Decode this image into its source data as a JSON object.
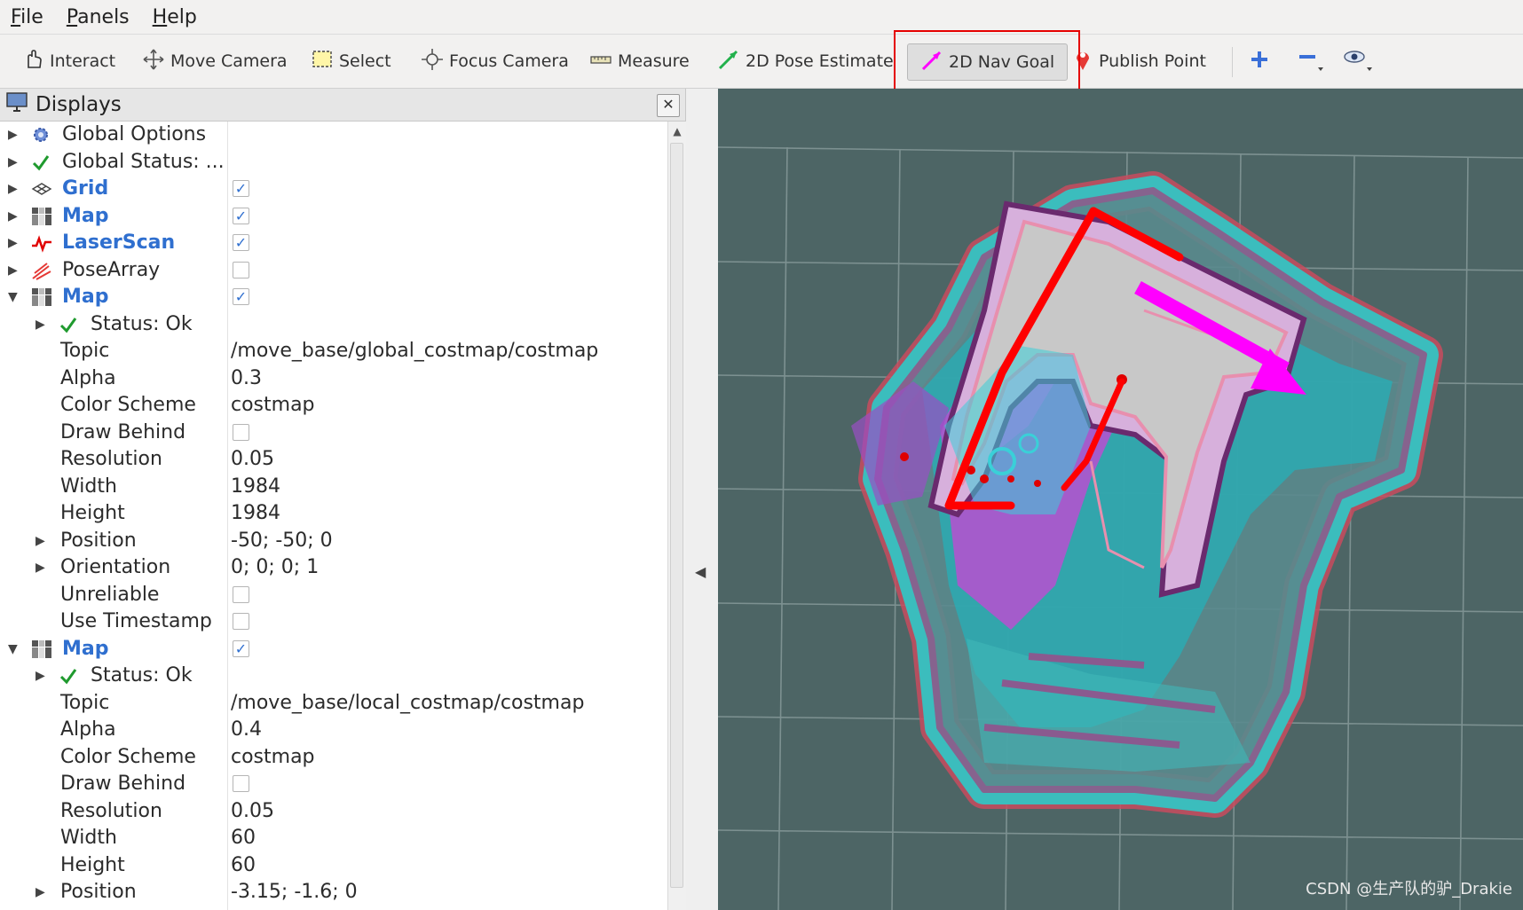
{
  "menubar": {
    "items": [
      "File",
      "Panels",
      "Help"
    ]
  },
  "toolbar": {
    "tools": [
      {
        "label": "Interact",
        "icon": "hand-icon"
      },
      {
        "label": "Move Camera",
        "icon": "move-camera-icon"
      },
      {
        "label": "Select",
        "icon": "select-icon"
      },
      {
        "label": "Focus Camera",
        "icon": "focus-camera-icon"
      },
      {
        "label": "Measure",
        "icon": "ruler-icon"
      },
      {
        "label": "2D Pose Estimate",
        "icon": "green-arrow-icon"
      },
      {
        "label": "2D Nav Goal",
        "icon": "magenta-arrow-icon",
        "active": true
      },
      {
        "label": "Publish Point",
        "icon": "map-pin-icon"
      }
    ],
    "extra_icons": [
      "plus-icon",
      "minus-icon",
      "eye-icon"
    ]
  },
  "displays_panel": {
    "title": "Displays",
    "rows": [
      {
        "label": "Global Options"
      },
      {
        "label": "Global Status: ..."
      },
      {
        "label": "Grid",
        "checked": true
      },
      {
        "label": "Map",
        "checked": true
      },
      {
        "label": "LaserScan",
        "checked": true
      },
      {
        "label": "PoseArray",
        "checked": false
      },
      {
        "label": "Map",
        "checked": true
      },
      {
        "label": "Status: Ok"
      },
      {
        "label": "Topic",
        "value": "/move_base/global_costmap/costmap"
      },
      {
        "label": "Alpha",
        "value": "0.3"
      },
      {
        "label": "Color Scheme",
        "value": "costmap"
      },
      {
        "label": "Draw Behind",
        "checked": false
      },
      {
        "label": "Resolution",
        "value": "0.05"
      },
      {
        "label": "Width",
        "value": "1984"
      },
      {
        "label": "Height",
        "value": "1984"
      },
      {
        "label": "Position",
        "value": "-50; -50; 0"
      },
      {
        "label": "Orientation",
        "value": "0; 0; 0; 1"
      },
      {
        "label": "Unreliable",
        "checked": false
      },
      {
        "label": "Use Timestamp",
        "checked": false
      },
      {
        "label": "Map",
        "checked": true
      },
      {
        "label": "Status: Ok"
      },
      {
        "label": "Topic",
        "value": "/move_base/local_costmap/costmap"
      },
      {
        "label": "Alpha",
        "value": "0.4"
      },
      {
        "label": "Color Scheme",
        "value": "costmap"
      },
      {
        "label": "Draw Behind",
        "checked": false
      },
      {
        "label": "Resolution",
        "value": "0.05"
      },
      {
        "label": "Width",
        "value": "60"
      },
      {
        "label": "Height",
        "value": "60"
      },
      {
        "label": "Position",
        "value": "-3.15; -1.6; 0"
      }
    ]
  },
  "watermark": "CSDN @生产队的驴_Drakie",
  "colors": {
    "viewport_bg": "#4d6565",
    "nav_goal_arrow": "#ff00ff",
    "path": "#ff0000",
    "highlight_box": "#e50000",
    "costmap_cyan": "#3fc9c9"
  }
}
